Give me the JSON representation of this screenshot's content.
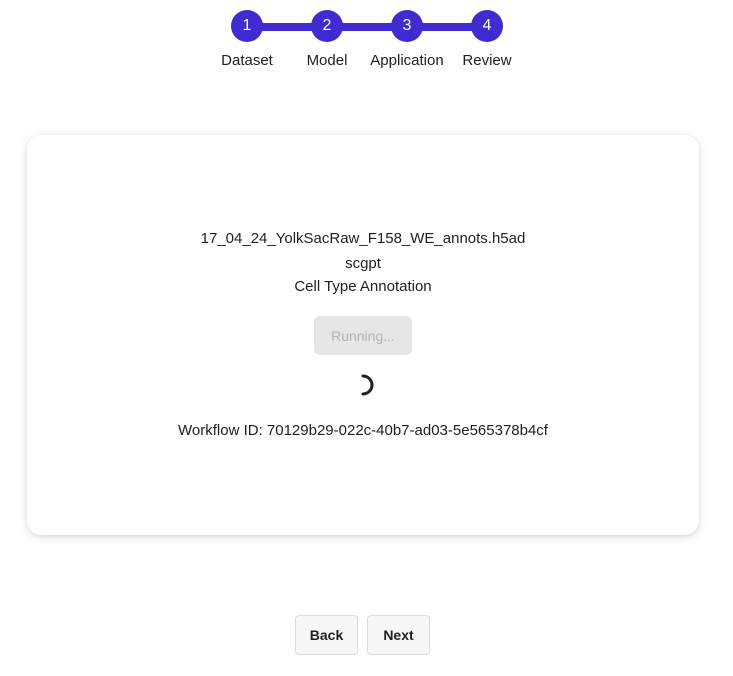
{
  "stepper": {
    "active_color": "#3f2bd0",
    "steps": [
      {
        "number": "1",
        "label": "Dataset"
      },
      {
        "number": "2",
        "label": "Model"
      },
      {
        "number": "3",
        "label": "Application"
      },
      {
        "number": "4",
        "label": "Review"
      }
    ]
  },
  "job": {
    "dataset_file": "17_04_24_YolkSacRaw_F158_WE_annots.h5ad",
    "model": "scgpt",
    "application": "Cell Type Annotation",
    "status_button_label": "Running...",
    "workflow_id_text": "Workflow ID: 70129b29-022c-40b7-ad03-5e565378b4cf"
  },
  "navigation": {
    "back_label": "Back",
    "next_label": "Next"
  }
}
